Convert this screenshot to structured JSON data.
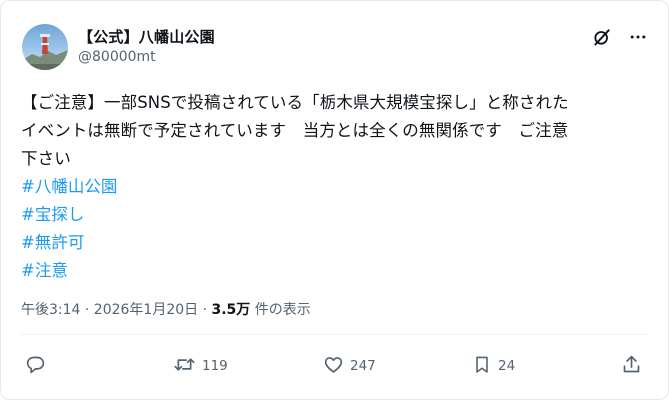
{
  "author": {
    "display_name": "【公式】八幡山公園",
    "handle": "@80000mt"
  },
  "tweet": {
    "text": "【ご注意】一部SNSで投稿されている「栃木県大規模宝探し」と称された\nイベントは無断で予定されています　当方とは全くの無関係です　ご注意\n下さい",
    "hashtags": [
      "#八幡山公園",
      "#宝探し",
      "#無許可",
      "#注意"
    ]
  },
  "meta": {
    "timestamp": "午後3:14 · 2026年1月20日 · ",
    "views_count": "3.5万",
    "views_label": " 件の表示"
  },
  "actions": {
    "replies": "",
    "reposts": "119",
    "likes": "247",
    "bookmarks": "24"
  },
  "icons": {
    "grok": "grok-icon",
    "more": "more-icon",
    "reply": "reply-icon",
    "repost": "repost-icon",
    "like": "like-icon",
    "bookmark": "bookmark-icon",
    "share": "share-icon"
  },
  "colors": {
    "link": "#1d9bf0",
    "secondary_text": "#536471",
    "primary_text": "#0f1419"
  }
}
